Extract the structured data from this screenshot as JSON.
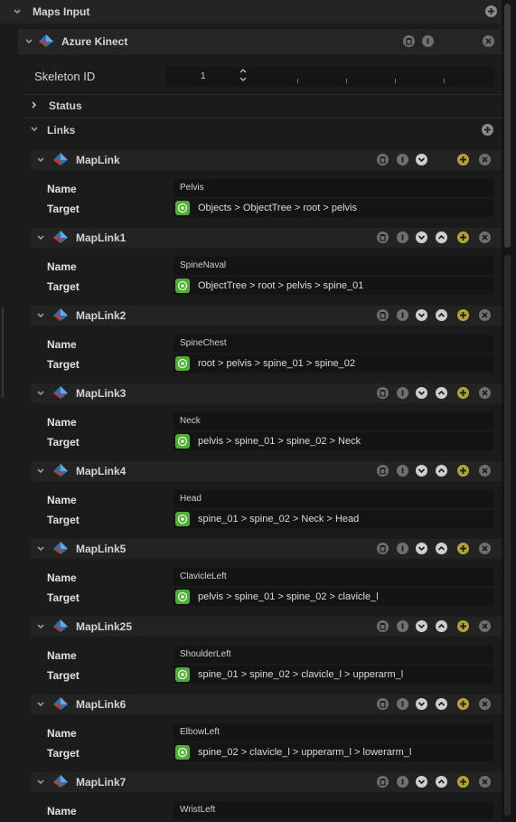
{
  "panel": {
    "title": "Maps Input"
  },
  "device": {
    "title": "Azure Kinect",
    "skeleton_label": "Skeleton ID",
    "skeleton_value": "1",
    "status_label": "Status",
    "links_label": "Links"
  },
  "links": [
    {
      "title": "MapLink",
      "name_label": "Name",
      "name": "Pelvis",
      "target_label": "Target",
      "target": "Objects > ObjectTree > root > pelvis"
    },
    {
      "title": "MapLink1",
      "name_label": "Name",
      "name": "SpineNaval",
      "target_label": "Target",
      "target": "ObjectTree > root > pelvis > spine_01"
    },
    {
      "title": "MapLink2",
      "name_label": "Name",
      "name": "SpineChest",
      "target_label": "Target",
      "target": "root > pelvis > spine_01 > spine_02"
    },
    {
      "title": "MapLink3",
      "name_label": "Name",
      "name": "Neck",
      "target_label": "Target",
      "target": "pelvis > spine_01 > spine_02 > Neck"
    },
    {
      "title": "MapLink4",
      "name_label": "Name",
      "name": "Head",
      "target_label": "Target",
      "target": "spine_01 > spine_02 > Neck > Head"
    },
    {
      "title": "MapLink5",
      "name_label": "Name",
      "name": "ClavicleLeft",
      "target_label": "Target",
      "target": "pelvis > spine_01 > spine_02 > clavicle_l"
    },
    {
      "title": "MapLink25",
      "name_label": "Name",
      "name": "ShoulderLeft",
      "target_label": "Target",
      "target": "spine_01 > spine_02 > clavicle_l > upperarm_l"
    },
    {
      "title": "MapLink6",
      "name_label": "Name",
      "name": "ElbowLeft",
      "target_label": "Target",
      "target": "spine_02 > clavicle_l > upperarm_l > lowerarm_l"
    },
    {
      "title": "MapLink7",
      "name_label": "Name",
      "name": "WristLeft",
      "target_label": "Target",
      "target": ""
    }
  ],
  "colors": {
    "background": "#1b1b1b",
    "header_row": "#262626",
    "field": "#141414",
    "add_button": "#b0a436",
    "target_icon": "#4fae35",
    "icon_grey": "#6f6f6f"
  }
}
